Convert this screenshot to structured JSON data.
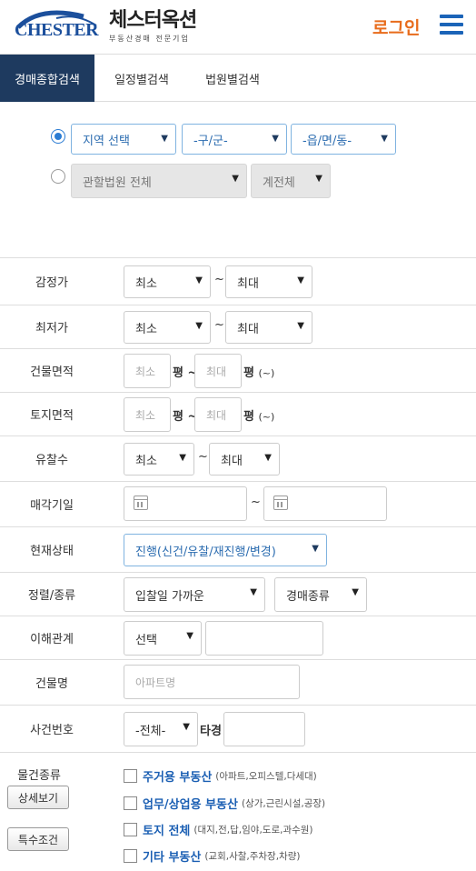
{
  "header": {
    "logo_en": "CHESTER",
    "logo_ko": "체스터옥션",
    "logo_sub": "부동산경매 전문기업",
    "login_label": "로그인",
    "menu_icon": "hamburger-menu-icon"
  },
  "tabs": [
    {
      "label": "경매종합검색",
      "active": true
    },
    {
      "label": "일정별검색",
      "active": false
    },
    {
      "label": "법원별검색",
      "active": false
    }
  ],
  "region": {
    "option1": {
      "selected": true,
      "area": "지역 선택",
      "gu": "-구/군-",
      "dong": "-읍/면/동-"
    },
    "option2": {
      "selected": false,
      "court": "관할법원 전체",
      "branch": "계전체"
    }
  },
  "fields": {
    "appraisal": {
      "label": "감정가",
      "min": "최소",
      "max": "최대"
    },
    "minimum": {
      "label": "최저가",
      "min": "최소",
      "max": "최대"
    },
    "building_area": {
      "label": "건물면적",
      "min_placeholder": "최소",
      "max_placeholder": "최대",
      "unit": "평",
      "unit_note": "(~)"
    },
    "land_area": {
      "label": "토지면적",
      "min_placeholder": "최소",
      "max_placeholder": "최대",
      "unit": "평",
      "unit_note": "(~)"
    },
    "fail_count": {
      "label": "유찰수",
      "min": "최소",
      "max": "최대"
    },
    "sale_date": {
      "label": "매각기일"
    },
    "status": {
      "label": "현재상태",
      "value": "진행(신건/유찰/재진행/변경)"
    },
    "sort": {
      "label": "정렬/종류",
      "order": "입찰일 가까운",
      "type": "경매종류"
    },
    "interest": {
      "label": "이해관계",
      "value": "선택"
    },
    "building_name": {
      "label": "건물명",
      "placeholder": "아파트명"
    },
    "case_number": {
      "label": "사건번호",
      "year": "-전체-",
      "suffix": "타경"
    }
  },
  "property_type": {
    "label": "물건종류",
    "detail_button": "상세보기",
    "special_button": "특수조건",
    "options": [
      {
        "title": "주거용 부동산",
        "desc": "(아파트,오피스텔,다세대)"
      },
      {
        "title": "업무/상업용 부동산",
        "desc": "(상가,근린시설,공장)"
      },
      {
        "title": "토지 전체",
        "desc": "(대지,전,답,임야,도로,과수원)"
      },
      {
        "title": "기타 부동산",
        "desc": "(교회,사찰,주차장,차량)"
      }
    ]
  },
  "colors": {
    "accent": "#1e3a5f",
    "brand_blue": "#1b4f9c",
    "login_orange": "#e86c1c",
    "link_blue": "#1b5fb3"
  }
}
